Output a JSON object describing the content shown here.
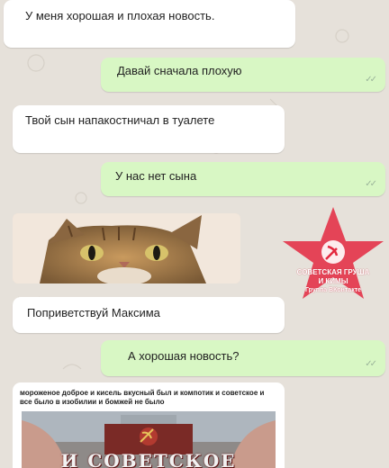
{
  "messages": [
    {
      "side": "in",
      "text": "У меня хорошая и плохая новость."
    },
    {
      "side": "out",
      "text": "Давай сначала плохую"
    },
    {
      "side": "in",
      "text": "Твой сын напакостничал в туалете"
    },
    {
      "side": "out",
      "text": "У нас нет сына"
    },
    {
      "side": "in",
      "text": "Поприветствуй Максима"
    },
    {
      "side": "out",
      "text": "А хорошая новость?"
    }
  ],
  "read_ticks": "✓✓",
  "watermark": {
    "line1": "СОВЕТСКАЯ ГРУША",
    "line2": "И КИМЫ",
    "line3": "Группа ВКонтакте"
  },
  "last_message": {
    "caption": "мороженое доброе и кисель вкусный был и компотик и советское и все было в изобилии и бомжей не было",
    "poster_text": "И СОВЕТСКОЕ"
  },
  "colors": {
    "incoming": "#ffffff",
    "outgoing": "#d8f7c4",
    "wallpaper": "#e6e1da",
    "stamp_red": "#e3283f"
  }
}
